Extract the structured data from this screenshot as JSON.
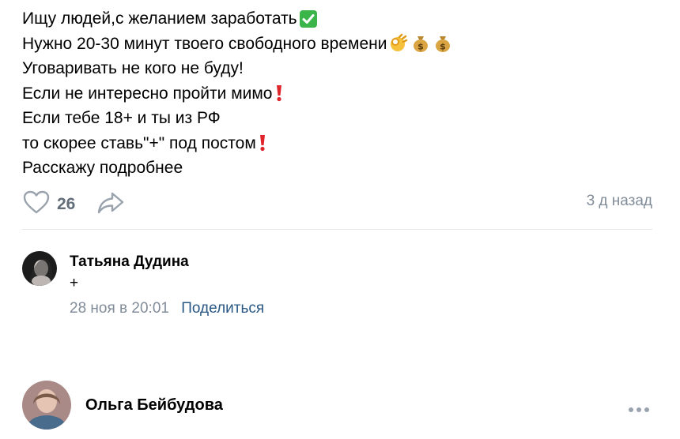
{
  "post": {
    "lines": [
      {
        "text": "Ищу людей,с желанием заработать",
        "emojis": [
          "check-mark"
        ]
      },
      {
        "text": "Нужно 20-30 минут твоего свободного времени ",
        "emojis": [
          "ok-hand",
          "money-bag",
          "money-bag"
        ]
      },
      {
        "text": "Уговаривать не кого не буду!",
        "emojis": []
      },
      {
        "text": "Если не интересно пройти мимо",
        "emojis": [
          "exclamation"
        ]
      },
      {
        "text": "Если тебе 18+ и ты из РФ",
        "emojis": []
      },
      {
        "text": "то скорее ставь\"+\" под постом",
        "emojis": [
          "exclamation"
        ]
      },
      {
        "text": "Расскажу подробнее",
        "emojis": []
      }
    ],
    "likes": "26",
    "time": "3 д назад"
  },
  "comments": [
    {
      "author": "Татьяна Дудина",
      "text": "+",
      "date": "28 ноя в 20:01",
      "share_label": "Поделиться"
    },
    {
      "author": "Ольга Бейбудова"
    }
  ],
  "colors": {
    "link": "#2a5885",
    "muted": "#818c99",
    "icon": "#99a2ad",
    "check_green": "#3bb54a",
    "exclamation_red": "#e0242c"
  }
}
